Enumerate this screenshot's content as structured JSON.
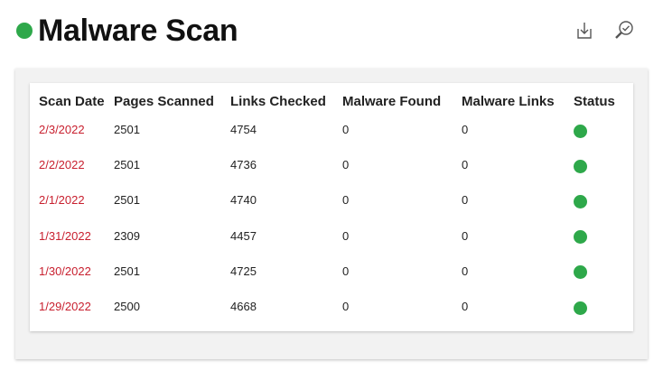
{
  "header": {
    "title": "Malware Scan",
    "status_color": "#2ea84a",
    "download_icon": "download-icon",
    "scan_icon": "search-check-icon"
  },
  "table": {
    "columns": [
      "Scan Date",
      "Pages Scanned",
      "Links Checked",
      "Malware Found",
      "Malware Links",
      "Status"
    ],
    "rows": [
      {
        "date": "2/3/2022",
        "pages": "2501",
        "links": "4754",
        "malware": "0",
        "malware_links": "0",
        "status": "ok"
      },
      {
        "date": "2/2/2022",
        "pages": "2501",
        "links": "4736",
        "malware": "0",
        "malware_links": "0",
        "status": "ok"
      },
      {
        "date": "2/1/2022",
        "pages": "2501",
        "links": "4740",
        "malware": "0",
        "malware_links": "0",
        "status": "ok"
      },
      {
        "date": "1/31/2022",
        "pages": "2309",
        "links": "4457",
        "malware": "0",
        "malware_links": "0",
        "status": "ok"
      },
      {
        "date": "1/30/2022",
        "pages": "2501",
        "links": "4725",
        "malware": "0",
        "malware_links": "0",
        "status": "ok"
      },
      {
        "date": "1/29/2022",
        "pages": "2500",
        "links": "4668",
        "malware": "0",
        "malware_links": "0",
        "status": "ok"
      }
    ],
    "link_color": "#c8202f",
    "status_ok_color": "#2ea84a"
  }
}
